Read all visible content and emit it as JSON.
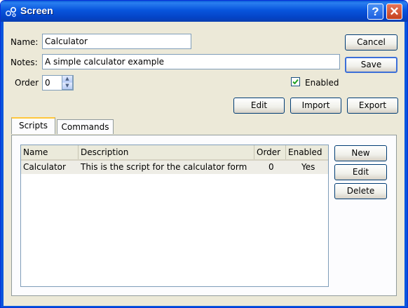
{
  "window": {
    "title": "Screen",
    "help_icon": "?",
    "close_icon": "✕"
  },
  "form": {
    "name_label": "Name:",
    "name_value": "Calculator",
    "notes_label": "Notes:",
    "notes_value": "A simple calculator example",
    "order_label": "Order",
    "order_value": "0",
    "enabled_label": "Enabled",
    "enabled_checked": true
  },
  "buttons": {
    "cancel": "Cancel",
    "save": "Save",
    "edit": "Edit",
    "import": "Import",
    "export": "Export"
  },
  "tabs": [
    {
      "label": "Scripts",
      "active": true
    },
    {
      "label": "Commands",
      "active": false
    }
  ],
  "scripts_table": {
    "columns": [
      "Name",
      "Description",
      "Order",
      "Enabled"
    ],
    "rows": [
      {
        "name": "Calculator",
        "description": "This is the script for the calculator form",
        "order": "0",
        "enabled": "Yes"
      }
    ]
  },
  "script_buttons": {
    "new": "New",
    "edit": "Edit",
    "delete": "Delete"
  }
}
